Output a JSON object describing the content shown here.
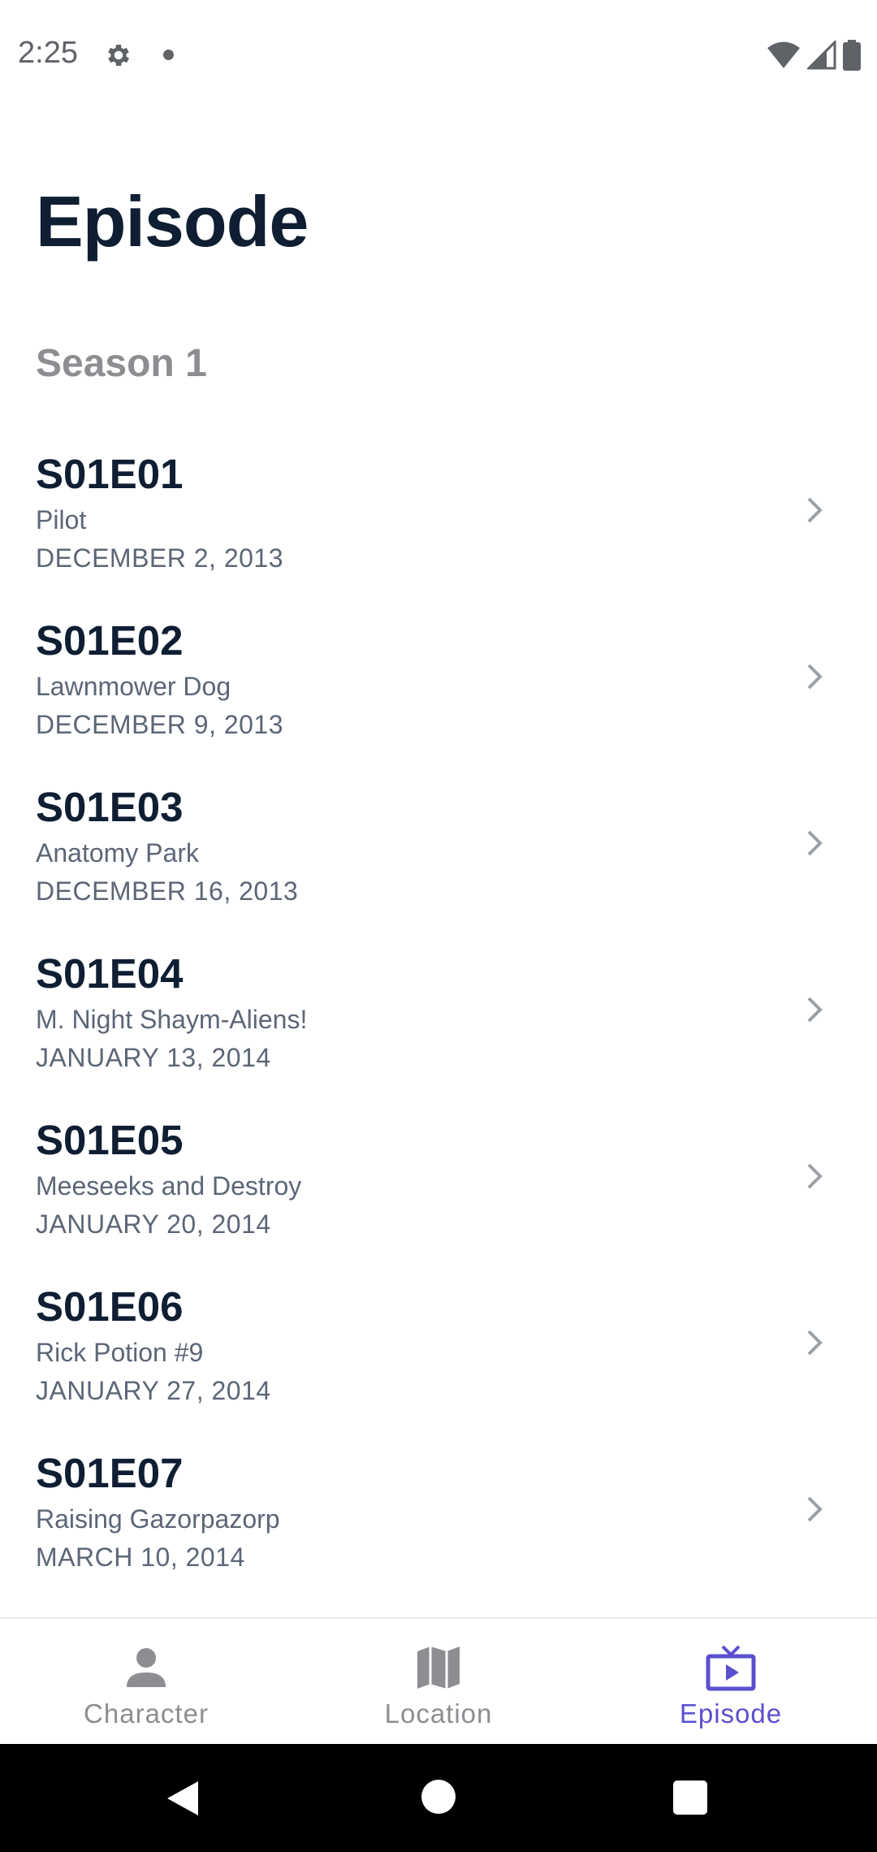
{
  "status_bar": {
    "time": "2:25",
    "icons": [
      "gear-icon",
      "notification-dot-icon",
      "wifi-icon",
      "signal-icon",
      "battery-icon"
    ]
  },
  "page": {
    "title": "Episode",
    "season_label": "Season 1"
  },
  "episodes": [
    {
      "code": "S01E01",
      "name": "Pilot",
      "air_date": "DECEMBER 2, 2013"
    },
    {
      "code": "S01E02",
      "name": "Lawnmower Dog",
      "air_date": "DECEMBER 9, 2013"
    },
    {
      "code": "S01E03",
      "name": "Anatomy Park",
      "air_date": "DECEMBER 16, 2013"
    },
    {
      "code": "S01E04",
      "name": "M. Night Shaym-Aliens!",
      "air_date": "JANUARY 13, 2014"
    },
    {
      "code": "S01E05",
      "name": "Meeseeks and Destroy",
      "air_date": "JANUARY 20, 2014"
    },
    {
      "code": "S01E06",
      "name": "Rick Potion #9",
      "air_date": "JANUARY 27, 2014"
    },
    {
      "code": "S01E07",
      "name": "Raising Gazorpazorp",
      "air_date": "MARCH 10, 2014"
    }
  ],
  "bottom_nav": {
    "items": [
      {
        "label": "Character",
        "icon": "person-icon",
        "active": false
      },
      {
        "label": "Location",
        "icon": "map-icon",
        "active": false
      },
      {
        "label": "Episode",
        "icon": "tv-icon",
        "active": true
      }
    ],
    "active_color": "#5b4fd0",
    "inactive_color": "#8d8d92"
  },
  "system_nav": {
    "icons": [
      "back-icon",
      "home-icon",
      "recents-icon"
    ]
  },
  "colors": {
    "title": "#0f1e33",
    "subtitle": "#5c6677",
    "season": "#8d8d92"
  }
}
